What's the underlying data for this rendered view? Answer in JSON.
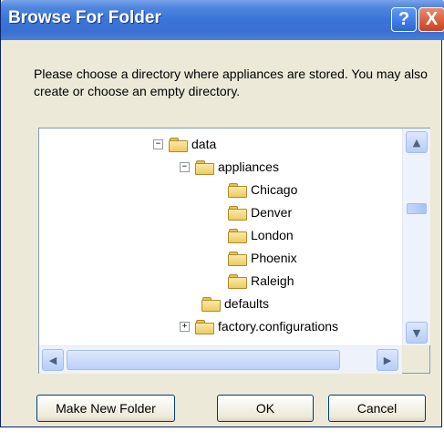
{
  "window": {
    "title": "Browse For Folder",
    "help_label": "?",
    "close_label": "X"
  },
  "instructions": "Please choose a directory where appliances are stored. You may also create or choose an empty directory.",
  "tree": {
    "items": [
      {
        "label": "data",
        "expander": "−"
      },
      {
        "label": "appliances",
        "expander": "−"
      },
      {
        "label": "Chicago",
        "expander": ""
      },
      {
        "label": "Denver",
        "expander": ""
      },
      {
        "label": "London",
        "expander": ""
      },
      {
        "label": "Phoenix",
        "expander": ""
      },
      {
        "label": "Raleigh",
        "expander": ""
      },
      {
        "label": "defaults",
        "expander": ""
      },
      {
        "label": "factory.configurations",
        "expander": "+"
      }
    ]
  },
  "scroll": {
    "up_arrow": "▲",
    "down_arrow": "▼",
    "left_arrow": "◀",
    "right_arrow": "▶"
  },
  "buttons": {
    "make_new_folder": "Make New Folder",
    "ok": "OK",
    "cancel": "Cancel"
  }
}
